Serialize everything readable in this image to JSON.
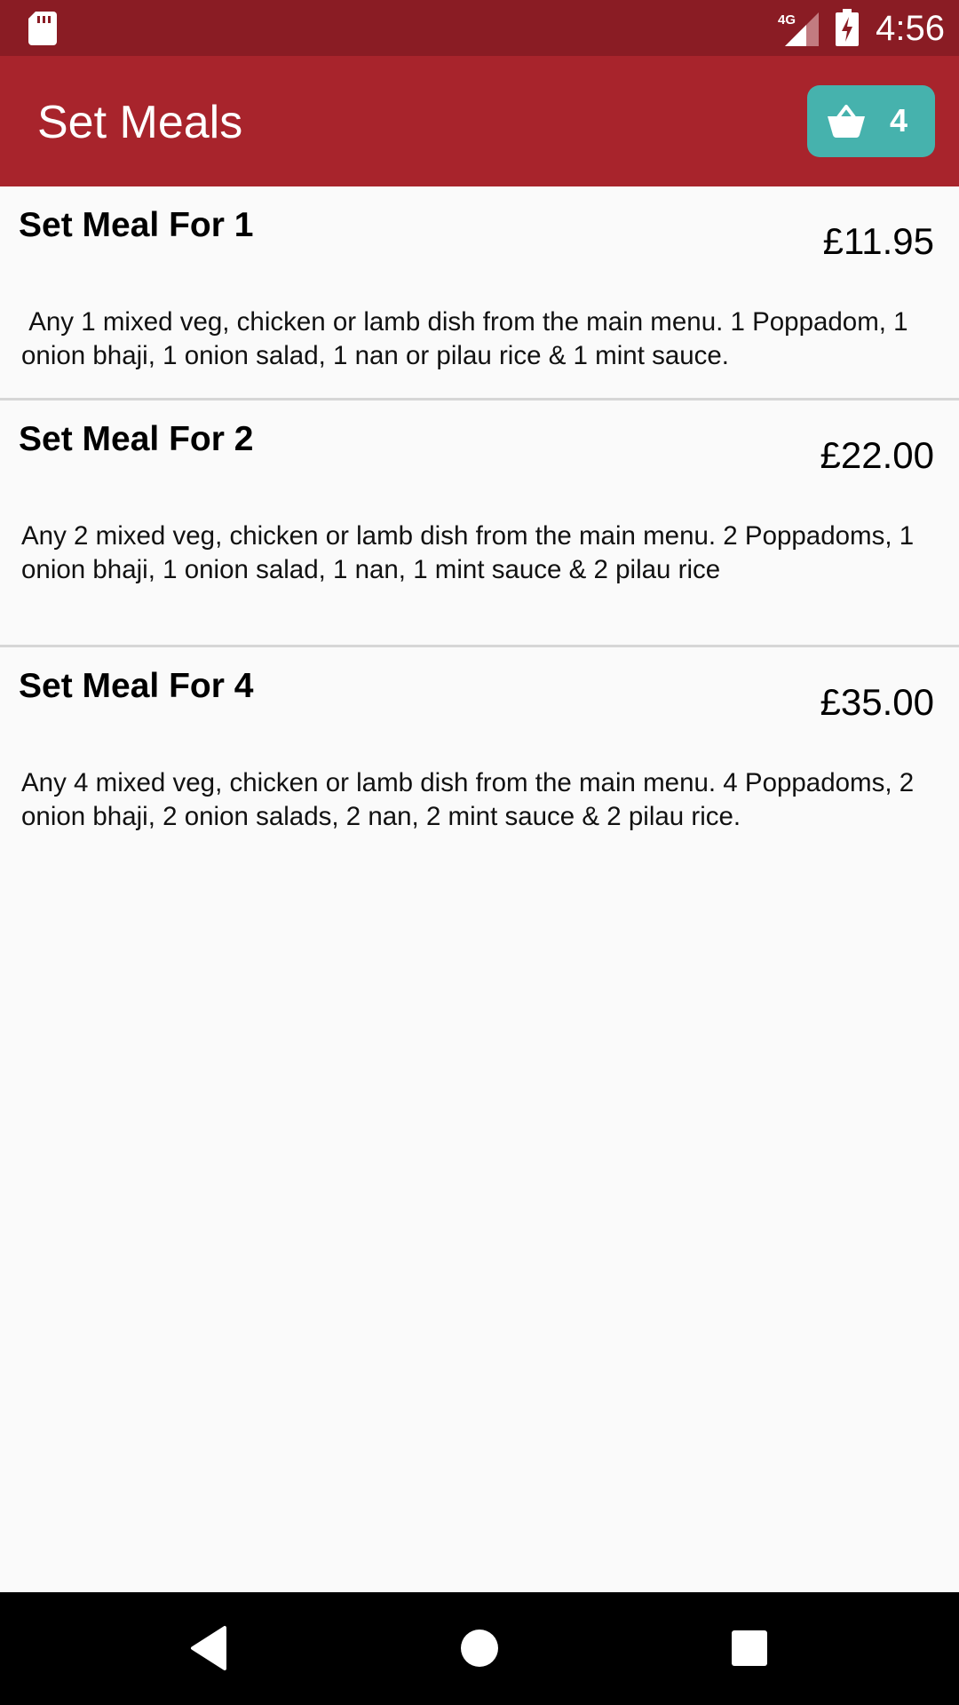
{
  "status_bar": {
    "time": "4:56",
    "network_label": "4G",
    "icons": [
      "sd-card-icon",
      "cell-signal-icon",
      "battery-charging-icon"
    ]
  },
  "app_bar": {
    "title": "Set Meals",
    "basket": {
      "icon": "basket-icon",
      "count": "4"
    }
  },
  "meals": [
    {
      "name": "Set Meal For 1",
      "price": "£11.95",
      "description": " Any 1 mixed veg, chicken or lamb dish from the main menu. 1 Poppadom, 1 onion bhaji, 1 onion salad, 1 nan or pilau rice & 1 mint sauce."
    },
    {
      "name": "Set Meal For 2",
      "price": "£22.00",
      "description": "Any 2 mixed veg, chicken or lamb dish from the main menu. 2 Poppadoms, 1 onion bhaji, 1 onion salad, 1 nan, 1 mint sauce & 2 pilau rice"
    },
    {
      "name": "Set Meal For 4",
      "price": "£35.00",
      "description": "Any 4 mixed veg, chicken or lamb dish from the main menu. 4 Poppadoms, 2 onion bhaji, 2 onion salads, 2 nan, 2 mint sauce & 2 pilau rice."
    }
  ],
  "nav_bar": {
    "icons": [
      "back-icon",
      "home-icon",
      "recents-icon"
    ]
  },
  "colors": {
    "status_bar": "#8a1c24",
    "app_bar": "#a8242c",
    "basket_button": "#46b2ad",
    "background": "#fafafa",
    "divider": "#d6d6d6"
  }
}
